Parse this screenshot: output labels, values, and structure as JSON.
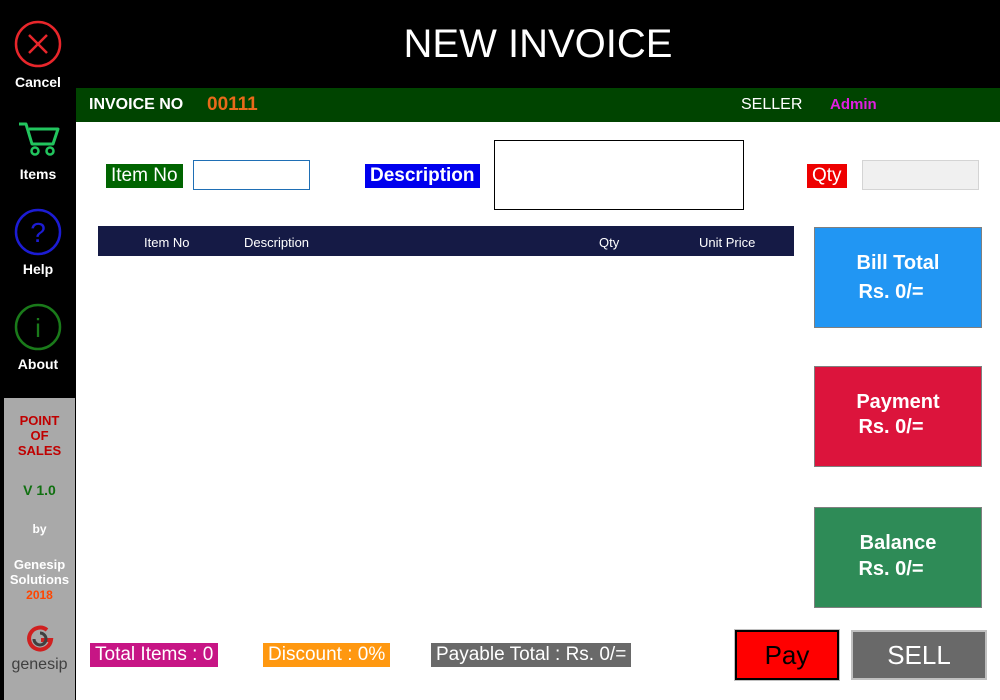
{
  "sidebar": {
    "cancel_label": "Cancel",
    "items_label": "Items",
    "help_label": "Help",
    "about_label": "About",
    "about_panel": {
      "line1": "POINT",
      "line2": "OF",
      "line3": "SALES",
      "version": "V 1.0",
      "by": "by",
      "company_line1": "Genesip",
      "company_line2": "Solutions",
      "year": "2018",
      "logo_text": "genesip"
    }
  },
  "header": {
    "title": "NEW INVOICE"
  },
  "infobar": {
    "invoice_label": "INVOICE NO",
    "invoice_no": "00111",
    "seller_label": "SELLER",
    "seller_name": "Admin"
  },
  "entry": {
    "item_no_label": "Item No",
    "item_no_value": "",
    "description_label": "Description",
    "description_value": "",
    "qty_label": "Qty",
    "qty_value": ""
  },
  "table": {
    "columns": [
      "Item No",
      "Description",
      "Qty",
      "Unit Price"
    ],
    "rows": []
  },
  "totals": {
    "bill_total_label": "Bill Total",
    "bill_total_value": "Rs. 0/=",
    "payment_label": "Payment",
    "payment_value": "Rs. 0/=",
    "balance_label": "Balance",
    "balance_value": "Rs. 0/="
  },
  "footer": {
    "total_items": "Total Items : 0",
    "discount": "Discount : 0%",
    "payable_total": "Payable Total : Rs. 0/="
  },
  "actions": {
    "pay_label": "Pay",
    "sell_label": "SELL"
  },
  "colors": {
    "cancel": "#e8262b",
    "items": "#22c55e",
    "help": "#1c1cd4",
    "about": "#1a7a1a",
    "infobar_bg": "#004400",
    "invoice_no": "#e86a1a",
    "seller_name": "#e01ee0",
    "bill_total": "#2196f3",
    "payment": "#dc143c",
    "balance": "#2e8b57"
  }
}
